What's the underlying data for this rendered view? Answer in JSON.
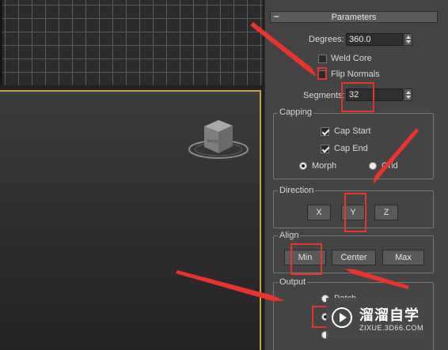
{
  "panel": {
    "rollout_toggle": "–",
    "rollout_title": "Parameters",
    "degrees": {
      "label": "Degrees:",
      "value": "360.0"
    },
    "weld_core": {
      "label": "Weld Core",
      "checked": false
    },
    "flip_normals": {
      "label": "Flip Normals",
      "checked": false
    },
    "segments": {
      "label": "Segments:",
      "value": "32"
    }
  },
  "capping": {
    "title": "Capping",
    "cap_start": {
      "label": "Cap Start",
      "checked": true
    },
    "cap_end": {
      "label": "Cap End",
      "checked": true
    },
    "morph": {
      "label": "Morph",
      "selected": true
    },
    "grid": {
      "label": "Grid",
      "selected": false
    }
  },
  "direction": {
    "title": "Direction",
    "x": "X",
    "y": "Y",
    "z": "Z"
  },
  "align": {
    "title": "Align",
    "min": "Min",
    "center": "Center",
    "max": "Max"
  },
  "output": {
    "title": "Output",
    "patch": "Patch"
  },
  "viewcube": {
    "face_label": "BACK"
  },
  "watermark": {
    "title": "溜溜自学",
    "url": "ZIXUE.3D66.COM"
  },
  "colors": {
    "annotation": "#e8332f",
    "active_viewport_border": "#c5a345",
    "panel_bg": "#444444"
  }
}
